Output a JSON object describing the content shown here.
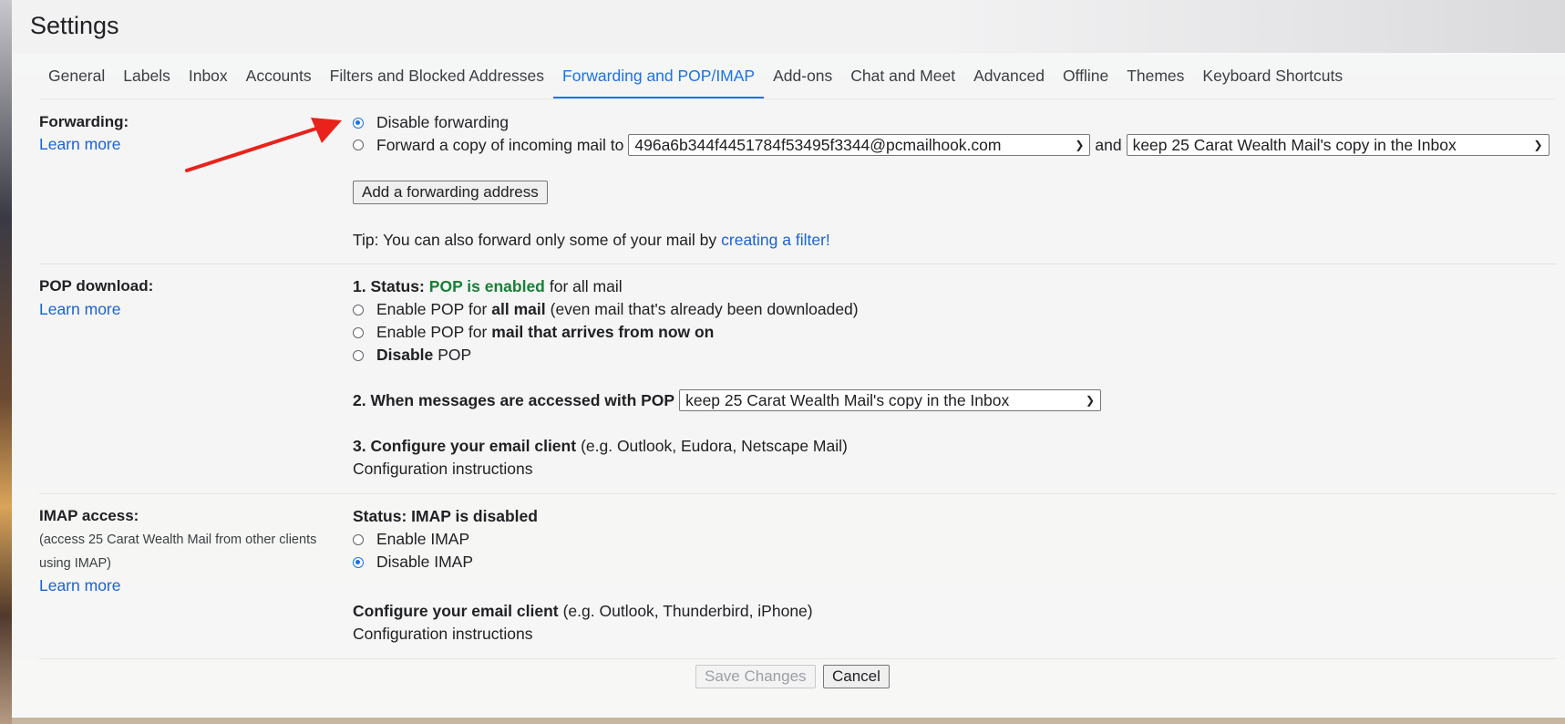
{
  "page_title": "Settings",
  "tabs": [
    {
      "label": "General"
    },
    {
      "label": "Labels"
    },
    {
      "label": "Inbox"
    },
    {
      "label": "Accounts"
    },
    {
      "label": "Filters and Blocked Addresses"
    },
    {
      "label": "Forwarding and POP/IMAP",
      "active": true
    },
    {
      "label": "Add-ons"
    },
    {
      "label": "Chat and Meet"
    },
    {
      "label": "Advanced"
    },
    {
      "label": "Offline"
    },
    {
      "label": "Themes"
    },
    {
      "label": "Keyboard Shortcuts"
    }
  ],
  "forwarding": {
    "label": "Forwarding:",
    "learn_more": "Learn more",
    "disable_label": "Disable forwarding",
    "forward_label": "Forward a copy of incoming mail to",
    "address_value": "496a6b344f4451784f53495f3344@pcmailhook.com",
    "and_text": "and",
    "copy_action_value": "keep 25 Carat Wealth Mail's copy in the Inbox",
    "add_button": "Add a forwarding address",
    "tip_text": "Tip: You can also forward only some of your mail by",
    "tip_link": "creating a filter!"
  },
  "pop": {
    "label": "POP download:",
    "learn_more": "Learn more",
    "status_prefix": "1. Status:",
    "status_value": "POP is enabled",
    "status_suffix": "for all mail",
    "opt1_prefix": "Enable POP for",
    "opt1_bold": "all mail",
    "opt1_suffix": "(even mail that's already been downloaded)",
    "opt2_prefix": "Enable POP for",
    "opt2_bold": "mail that arrives from now on",
    "opt3_bold": "Disable",
    "opt3_suffix": "POP",
    "when_label": "2. When messages are accessed with POP",
    "when_value": "keep 25 Carat Wealth Mail's copy in the Inbox",
    "configure_bold": "3. Configure your email client",
    "configure_suffix": "(e.g. Outlook, Eudora, Netscape Mail)",
    "config_link": "Configuration instructions"
  },
  "imap": {
    "label": "IMAP access:",
    "sub_text": "(access 25 Carat Wealth Mail from other clients using IMAP)",
    "learn_more": "Learn more",
    "status": "Status: IMAP is disabled",
    "enable_label": "Enable IMAP",
    "disable_label": "Disable IMAP",
    "configure_bold": "Configure your email client",
    "configure_suffix": "(e.g. Outlook, Thunderbird, iPhone)",
    "config_link": "Configuration instructions"
  },
  "footer": {
    "save_label": "Save Changes",
    "cancel_label": "Cancel"
  },
  "colors": {
    "accent": "#1a73e8",
    "link": "#1a63d2",
    "status_green": "#188038",
    "annotation_arrow": "#e8231b"
  }
}
